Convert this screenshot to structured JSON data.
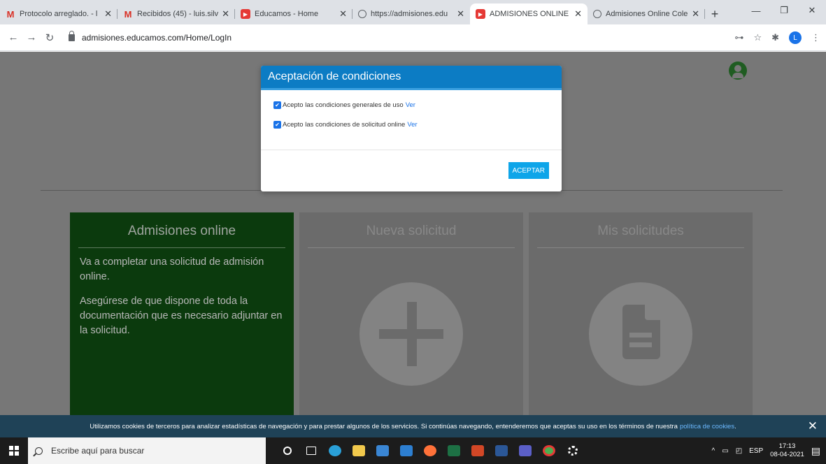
{
  "browser": {
    "tabs": [
      {
        "title": "Protocolo arreglado. - l",
        "favicon": "gmail-icon",
        "active": false
      },
      {
        "title": "Recibidos (45) - luis.silv",
        "favicon": "gmail-icon",
        "active": false
      },
      {
        "title": "Educamos - Home",
        "favicon": "red-logo-icon",
        "active": false
      },
      {
        "title": "https://admisiones.edu",
        "favicon": "globe-icon",
        "active": false
      },
      {
        "title": "ADMISIONES ONLINE",
        "favicon": "red-logo-icon",
        "active": true
      },
      {
        "title": "Admisiones Online Cole",
        "favicon": "globe-icon",
        "active": false
      }
    ],
    "new_tab": "+",
    "url": "admisiones.educamos.com/Home/LogIn",
    "profile_initial": "L"
  },
  "page": {
    "cards": [
      {
        "title": "Admisiones online",
        "paragraphs": [
          "Va a completar una solicitud de admisión online.",
          "Asegúrese de que dispone de toda la documentación que es necesario adjuntar en la solicitud."
        ]
      },
      {
        "title": "Nueva solicitud",
        "icon": "plus-icon"
      },
      {
        "title": "Mis solicitudes",
        "icon": "document-icon"
      }
    ]
  },
  "modal": {
    "title": "Aceptación de condiciones",
    "checks": [
      {
        "label": "Acepto las condiciones generales de uso",
        "link": "Ver",
        "checked": true
      },
      {
        "label": "Acepto las condiciones de solicitud online",
        "link": "Ver",
        "checked": true
      }
    ],
    "accept": "ACEPTAR"
  },
  "cookie": {
    "text": "Utilizamos cookies de terceros para analizar estadísticas de navegación y para prestar algunos de los servicios. Si continúas navegando, entenderemos que aceptas su uso en los términos de nuestra",
    "link": "política de cookies",
    "close": "✕"
  },
  "taskbar": {
    "search_placeholder": "Escribe aquí para buscar",
    "lang": "ESP",
    "time": "17:13",
    "date": "08-04-2021"
  },
  "colors": {
    "modal_header": "#0c7cc4",
    "accent_green": "#0b3a0d",
    "cookie_bar": "#1f4257",
    "accept_button": "#0ea5e9"
  }
}
